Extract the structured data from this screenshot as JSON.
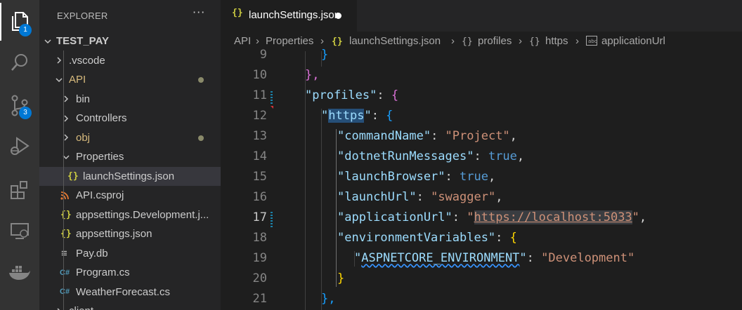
{
  "colors": {
    "accent": "#0078d4",
    "tab_dot": "#ffffff",
    "json_icon": "#cbcb41",
    "rss_icon": "#e37933",
    "cs_icon": "#519aba"
  },
  "activity_bar": {
    "items": [
      {
        "icon": "files-icon",
        "badge": "1"
      },
      {
        "icon": "search-icon",
        "badge": ""
      },
      {
        "icon": "source-control-icon",
        "badge": "3"
      },
      {
        "icon": "run-debug-icon",
        "badge": ""
      },
      {
        "icon": "extensions-icon",
        "badge": ""
      },
      {
        "icon": "remote-explorer-icon",
        "badge": ""
      },
      {
        "icon": "docker-icon",
        "badge": ""
      }
    ]
  },
  "sidebar": {
    "title": "EXPLORER",
    "more": "···",
    "tree": [
      {
        "label": "TEST_PAY",
        "type": "root"
      },
      {
        "label": ".vscode",
        "type": "folder"
      },
      {
        "label": "API",
        "type": "folder"
      },
      {
        "label": "bin",
        "type": "folder"
      },
      {
        "label": "Controllers",
        "type": "folder"
      },
      {
        "label": "obj",
        "type": "folder"
      },
      {
        "label": "Properties",
        "type": "folder"
      },
      {
        "label": "launchSettings.json",
        "type": "file",
        "icon": "{}"
      },
      {
        "label": "API.csproj",
        "type": "file",
        "icon": "rss"
      },
      {
        "label": "appsettings.Development.j...",
        "type": "file",
        "icon": "{}"
      },
      {
        "label": "appsettings.json",
        "type": "file",
        "icon": "{}"
      },
      {
        "label": "Pay.db",
        "type": "file",
        "icon": "≡"
      },
      {
        "label": "Program.cs",
        "type": "file",
        "icon": "C#"
      },
      {
        "label": "WeatherForecast.cs",
        "type": "file",
        "icon": "C#"
      },
      {
        "label": "client",
        "type": "folder"
      }
    ]
  },
  "editor": {
    "tab": {
      "icon": "{}",
      "label": "launchSettings.json",
      "modified": true
    },
    "breadcrumbs": [
      "API",
      "Properties",
      "launchSettings.json",
      "profiles",
      "https",
      "applicationUrl"
    ],
    "line_numbers": [
      "9",
      "10",
      "11",
      "12",
      "13",
      "14",
      "15",
      "16",
      "17",
      "18",
      "19",
      "20",
      "21"
    ],
    "code": {
      "l9": "}",
      "l10": "},",
      "l11_key": "\"profiles\"",
      "l12_key": "\"https\"",
      "l13_key": "\"commandName\"",
      "l13_val": "\"Project\"",
      "l14_key": "\"dotnetRunMessages\"",
      "l14_val": "true",
      "l15_key": "\"launchBrowser\"",
      "l15_val": "true",
      "l16_key": "\"launchUrl\"",
      "l16_val": "\"swagger\"",
      "l17_key": "\"applicationUrl\"",
      "l17_val": "https://localhost:5033",
      "l18_key": "\"environmentVariables\"",
      "l19_key": "ASPNETCORE_ENVIRONMENT",
      "l19_val": "\"Development\"",
      "l20": "}",
      "l21": "},"
    }
  }
}
